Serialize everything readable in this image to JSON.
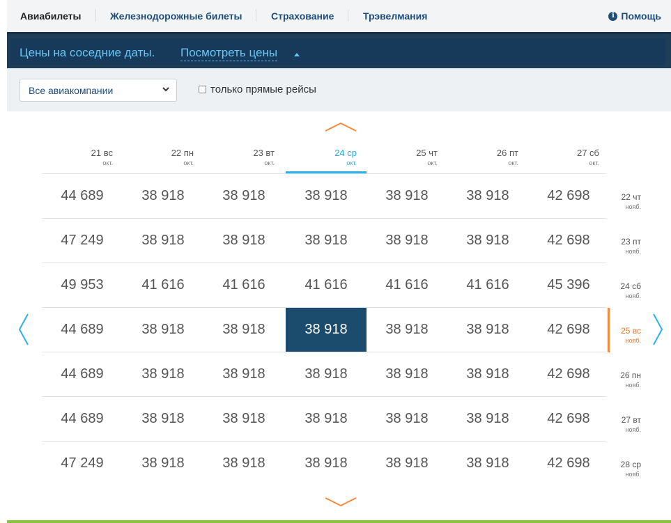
{
  "nav": {
    "items": [
      "Авиабилеты",
      "Железнодорожные билеты",
      "Страхование",
      "Трэвелмания"
    ],
    "help": "Помощь"
  },
  "banner": {
    "text": "Цены на соседние даты.",
    "link": "Посмотреть цены"
  },
  "filters": {
    "airline_select": "Все авиакомпании",
    "direct_checkbox": "только прямые рейсы",
    "direct_checked": false
  },
  "departure_dates": [
    {
      "day": "21 вс",
      "month": "окт."
    },
    {
      "day": "22 пн",
      "month": "окт."
    },
    {
      "day": "23 вт",
      "month": "окт."
    },
    {
      "day": "24 ср",
      "month": "окт."
    },
    {
      "day": "25 чт",
      "month": "окт."
    },
    {
      "day": "26 пт",
      "month": "окт."
    },
    {
      "day": "27 сб",
      "month": "окт."
    }
  ],
  "return_dates": [
    {
      "day": "22 чт",
      "month": "нояб."
    },
    {
      "day": "23 пт",
      "month": "нояб."
    },
    {
      "day": "24 сб",
      "month": "нояб."
    },
    {
      "day": "25 вс",
      "month": "нояб."
    },
    {
      "day": "26 пн",
      "month": "нояб."
    },
    {
      "day": "27 вт",
      "month": "нояб."
    },
    {
      "day": "28 ср",
      "month": "нояб."
    }
  ],
  "prices": [
    [
      "44 689",
      "38 918",
      "38 918",
      "38 918",
      "38 918",
      "38 918",
      "42 698"
    ],
    [
      "47 249",
      "38 918",
      "38 918",
      "38 918",
      "38 918",
      "38 918",
      "42 698"
    ],
    [
      "49 953",
      "41 616",
      "41 616",
      "41 616",
      "41 616",
      "41 616",
      "45 396"
    ],
    [
      "44 689",
      "38 918",
      "38 918",
      "38 918",
      "38 918",
      "38 918",
      "42 698"
    ],
    [
      "44 689",
      "38 918",
      "38 918",
      "38 918",
      "38 918",
      "38 918",
      "42 698"
    ],
    [
      "44 689",
      "38 918",
      "38 918",
      "38 918",
      "38 918",
      "38 918",
      "42 698"
    ],
    [
      "47 249",
      "38 918",
      "38 918",
      "38 918",
      "38 918",
      "38 918",
      "42 698"
    ]
  ],
  "selected": {
    "row": 3,
    "col": 3
  },
  "colors": {
    "accent_blue": "#2ab2e6",
    "selected_cell": "#1b4b6d",
    "active_row": "#f58b3c",
    "banner": "#17395a",
    "bottom_bar": "#8bc53f"
  },
  "icons": {
    "help": "info-icon",
    "up": "chevron-up-icon",
    "down": "chevron-down-icon",
    "left": "chevron-left-icon",
    "right": "chevron-right-icon",
    "select": "chevron-down-icon"
  }
}
